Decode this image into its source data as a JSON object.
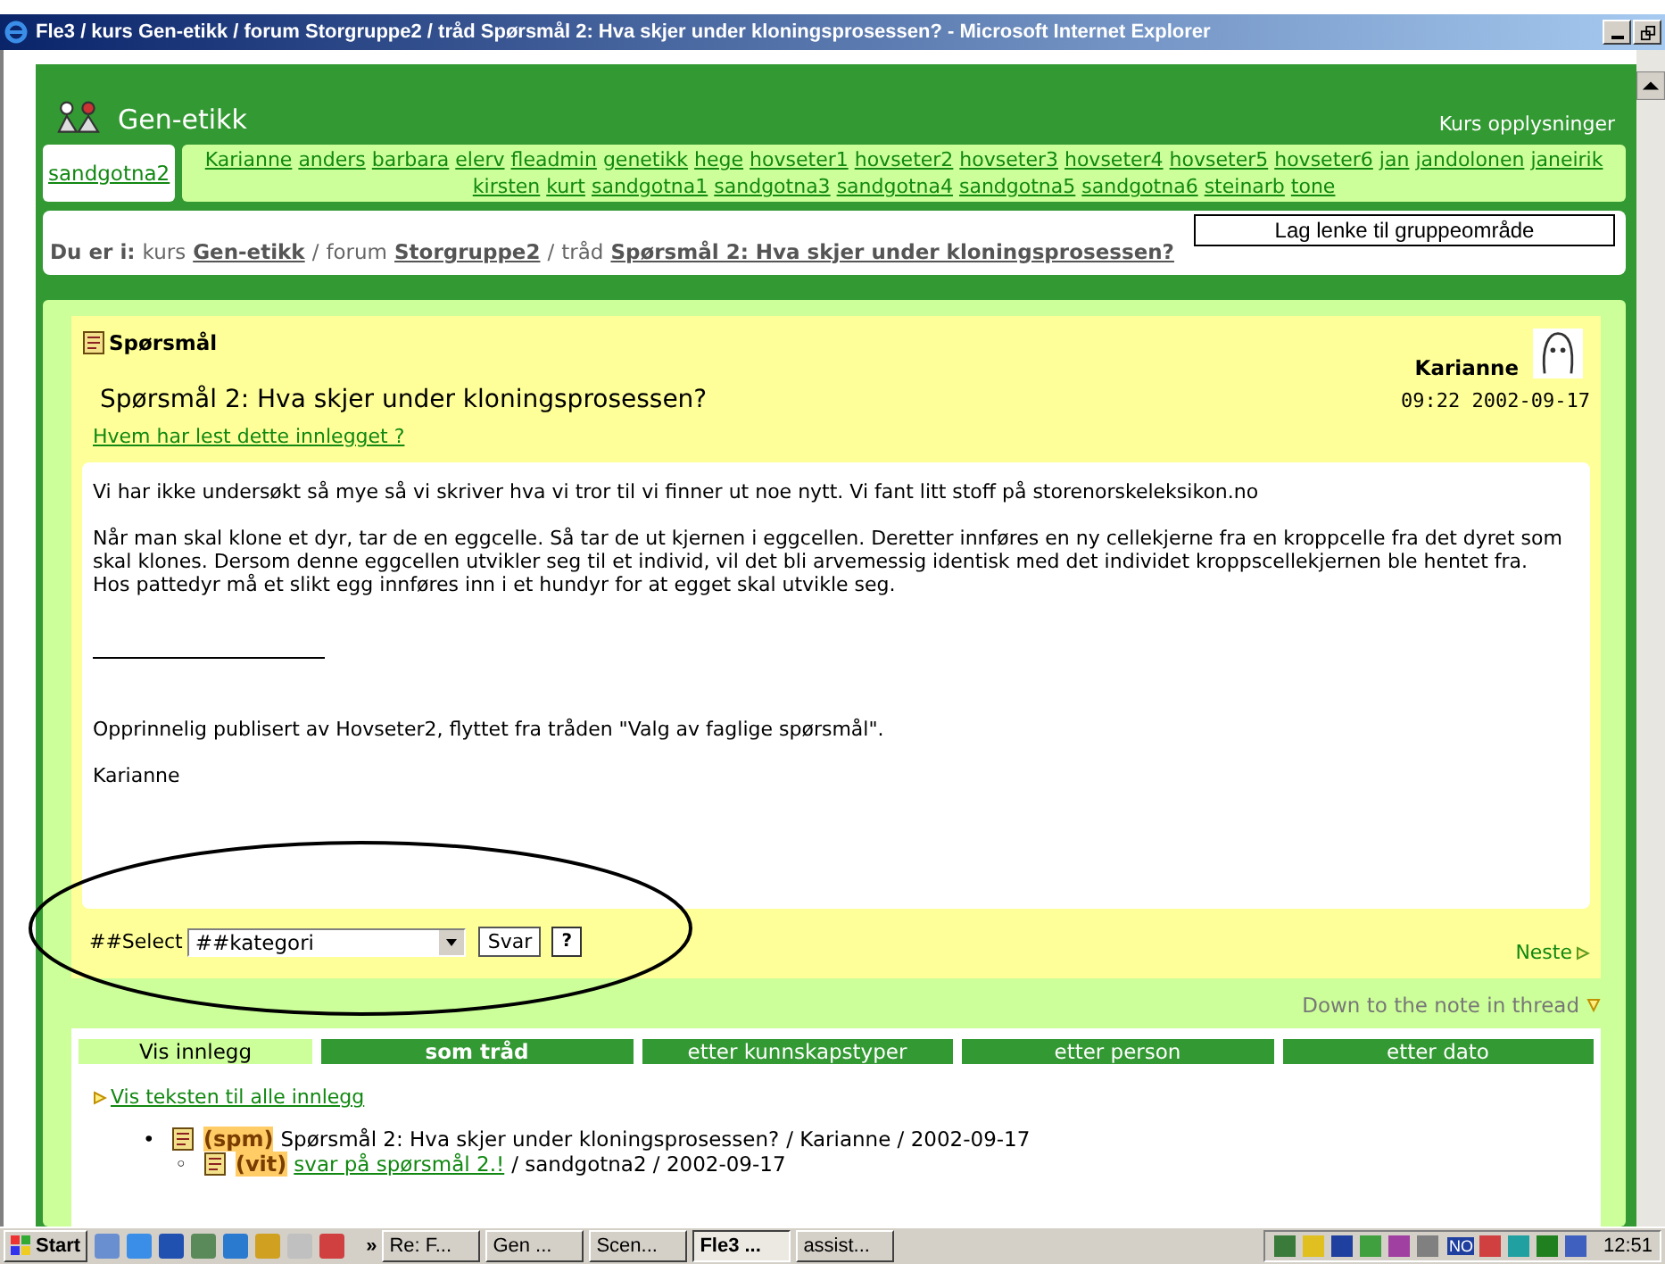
{
  "window": {
    "title": "Fle3 / kurs Gen-etikk / forum Storgruppe2 / tråd Spørsmål 2: Hva skjer under kloningsprosessen? - Microsoft Internet Explorer"
  },
  "course": {
    "title": "Gen-etikk",
    "info_link": "Kurs opplysninger"
  },
  "current_user": "sandgotna2",
  "members": [
    "Karianne",
    "anders",
    "barbara",
    "elerv",
    "fleadmin",
    "genetikk",
    "hege",
    "hovseter1",
    "hovseter2",
    "hovseter3",
    "hovseter4",
    "hovseter5",
    "hovseter6",
    "jan",
    "jandolonen",
    "janeirik",
    "kirsten",
    "kurt",
    "sandgotna1",
    "sandgotna3",
    "sandgotna4",
    "sandgotna5",
    "sandgotna6",
    "steinarb",
    "tone"
  ],
  "breadcrumb": {
    "label": "Du er i:",
    "parts": [
      {
        "prefix": "kurs",
        "link": "Gen-etikk",
        "after": "/"
      },
      {
        "prefix": "forum",
        "link": "Storgruppe2",
        "after": "/"
      },
      {
        "prefix": "tråd",
        "link": "Spørsmål 2: Hva skjer under kloningsprosessen?"
      }
    ]
  },
  "link_button": "Lag lenke til gruppeområde",
  "post": {
    "type": "Spørsmål",
    "author": "Karianne",
    "title": "Spørsmål 2: Hva skjer under kloningsprosessen?",
    "time": "09:22 2002-09-17",
    "read_link": "Hvem har lest dette innlegget ?",
    "paragraphs": [
      [
        "Vi har ikke undersøkt så mye så vi skriver hva vi tror til vi finner ut noe nytt. Vi fant litt stoff på storenorskeleksikon.no"
      ],
      [
        "Når man skal klone et dyr, tar de en eggcelle. Så tar de ut kjernen i eggcellen. Deretter innføres en ny cellekjerne fra en kroppcelle fra det dyret som skal klones. Dersom denne eggcellen utvikler seg til et individ, vil det bli arvemessig identisk med det individet kroppscellekjernen ble hentet fra.",
        "Hos pattedyr må et slikt egg innføres inn i et hundyr for at egget skal utvikle seg."
      ]
    ],
    "footer": [
      "Opprinnelig publisert av Hovseter2, flyttet fra tråden \"Valg av faglige spørsmål\".",
      "Karianne"
    ]
  },
  "reply_form": {
    "label": "##Select",
    "select_value": "##kategori",
    "button": "Svar",
    "help": "?"
  },
  "next_link": "Neste",
  "down_link": "Down to the note in thread",
  "view": {
    "label": "Vis innlegg",
    "tabs": [
      {
        "label": "som tråd",
        "selected": true
      },
      {
        "label": "etter kunnskapstyper",
        "selected": false
      },
      {
        "label": "etter person",
        "selected": false
      },
      {
        "label": "etter dato",
        "selected": false
      }
    ]
  },
  "show_all_link": "Vis teksten til alle innlegg",
  "thread": [
    {
      "bullet": "•",
      "tag": "(spm)",
      "title": "Spørsmål 2: Hva skjer under kloningsprosessen?",
      "is_link": false,
      "sep": "/",
      "author": "Karianne",
      "date": "2002-09-17",
      "children": [
        {
          "bullet": "◦",
          "tag": "(vit)",
          "title": "svar på spørsmål 2.!",
          "is_link": true,
          "sep": "/",
          "author": "sandgotna2",
          "date": "2002-09-17"
        }
      ]
    }
  ],
  "taskbar": {
    "start": "Start",
    "more": "»",
    "tasks": [
      {
        "label": "Re: F...",
        "selected": false
      },
      {
        "label": "Gen ...",
        "selected": false
      },
      {
        "label": "Scen...",
        "selected": false
      },
      {
        "label": "Fle3 ...",
        "selected": true
      },
      {
        "label": "assist...",
        "selected": false
      }
    ],
    "language": "NO",
    "clock": "12:51"
  }
}
